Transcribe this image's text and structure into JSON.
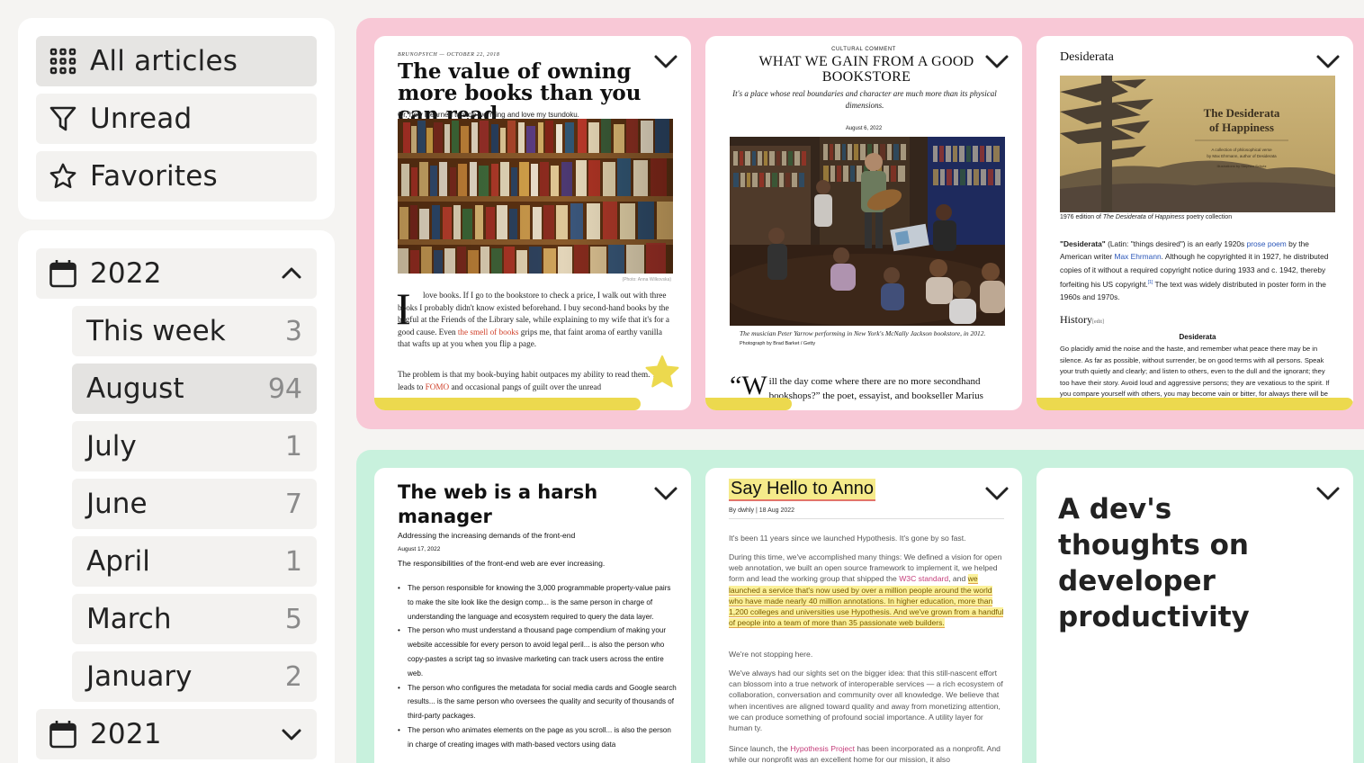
{
  "sidebar": {
    "filters": [
      {
        "label": "All articles",
        "icon": "grid-icon"
      },
      {
        "label": "Unread",
        "icon": "filter-icon"
      },
      {
        "label": "Favorites",
        "icon": "star-icon"
      }
    ],
    "years": [
      {
        "label": "2022",
        "expanded": true
      },
      {
        "label": "2021",
        "expanded": false
      }
    ],
    "months": [
      {
        "label": "This week",
        "count": "3"
      },
      {
        "label": "August",
        "count": "94"
      },
      {
        "label": "July",
        "count": "1"
      },
      {
        "label": "June",
        "count": "7"
      },
      {
        "label": "April",
        "count": "1"
      },
      {
        "label": "March",
        "count": "5"
      },
      {
        "label": "January",
        "count": "2"
      }
    ]
  },
  "cards": {
    "c1": {
      "kicker": "BRUNOPSYCH — OCTOBER 22, 2018",
      "title": "The value of owning more books than you can read",
      "subtitle": "Or, how I learned to stop worrying and love my tsundoku.",
      "caption": "(Photo: Anna Wilkovska)",
      "drop": "I",
      "body_a": "love books. If I go to the bookstore to check a price, I walk out with three books I probably didn't know existed beforehand. I buy second-hand books by the bagful at the Friends of the Library sale, while explaining to my wife that it's for a good cause. Even",
      "body_link": "the smell of books",
      "body_b": "grips me, that faint aroma of earthy vanilla that wafts up at you when you flip a page.",
      "body2_a": "The problem is that my book-buying habit outpaces my ability to read them. This leads to",
      "body2_link": "FOMO",
      "body2_b": "and occasional pangs of guilt over the unread",
      "progress": 0.8
    },
    "c2": {
      "kicker": "CULTURAL COMMENT",
      "title": "WHAT WE GAIN FROM A GOOD BOOKSTORE",
      "subtitle": "It's a place whose real boundaries and character are much more than its physical dimensions.",
      "date": "August 6, 2022",
      "caption_a": "The musician Peter Yarrow performing in New York's McNally Jackson bookstore, in 2012.",
      "caption_b": "Photograph by Brad Barket / Getty",
      "quote_cap": "“W",
      "quote": "ill the day come where there are no more secondhand bookshops?” the poet, essayist, and bookseller Marius",
      "progress": 0.27
    },
    "c3": {
      "title": "Desiderata",
      "img_title": "The Desiderata of Happiness",
      "img_sub": "A collection of philosophical verse by Max Ehrmann, author of Desiderata",
      "img_small": "Illustrations by Stephen Schutz",
      "caption_a": "1976 edition of",
      "caption_b": "The Desiderata of Happiness",
      "caption_c": "poetry collection",
      "body_bold": "\"Desiderata\"",
      "body_a": "(Latin: \"things desired\") is an early 1920s",
      "body_link1": "prose poem",
      "body_b": "by the American writer",
      "body_link2": "Max Ehrmann",
      "body_c": ". Although he copyrighted it in 1927, he distributed copies of it without a required copyright notice during 1933 and c. 1942, thereby forfeiting his US copyright.",
      "body_ref": "[1]",
      "body_d": "The text was widely distributed in poster form in the 1960s and 1970s.",
      "history": "History",
      "history_edit": "[edit]",
      "poem_title": "Desiderata",
      "poem": "Go placidly amid the noise and the haste, and remember what peace there may be in silence. As far as possible, without surrender, be on good terms with all persons. Speak your truth quietly and clearly; and listen to others, even to the dull and the ignorant; they too have their story. Avoid loud and aggressive persons; they are vexatious to the spirit. If you compare yourself with others, you may become vain or bitter, for always there will be",
      "progress": 1.0
    },
    "c4": {
      "title": "The web is a harsh manager",
      "subtitle": "Addressing the increasing demands of the front-end",
      "date": "August 17, 2022",
      "intro": "The responsibilities of the front-end web are ever increasing.",
      "items": [
        "The person responsible for knowing the 3,000 programmable property-value pairs to make the site look like the design comp... is the same person in charge of understanding the language and ecosystem required to query the data layer.",
        "The person who must understand a thousand page compendium of making your website accessible for every person to avoid legal peril... is also the person who copy-pastes a script tag so invasive marketing can track users across the entire web.",
        "The person who configures the metadata for social media cards and Google search results... is the same person who oversees the quality and security of thousands of third-party packages.",
        "The person who animates elements on the page as you scroll... is also the person in charge of creating images with math-based vectors using data"
      ]
    },
    "c5": {
      "title": "Say Hello to Anno",
      "meta": "By dwhly | 18 Aug 2022",
      "p1": "It's been 11 years since we launched Hypothesis. It's gone by so fast.",
      "p2_a": "During this time, we've accomplished many things: We defined a vision for open web annotation, we built an open source framework to implement it, we helped form and lead the working group that shipped the",
      "p2_link": "W3C standard",
      "p2_b": ", and",
      "p2_hl": "we launched a service that's now used by over a million people around the world who have made nearly 40 million annotations. In higher education, more than 1,200 colleges and universities use Hypothesis. And we've grown from a handful of people into a team of more than 35 passionate web builders.",
      "p3": "We're not stopping here.",
      "p4": "We've always had our sights set on the bigger idea: that this still-nascent effort can blossom into a true network of interoperable services — a rich ecosystem of collaboration, conversation and community over all knowledge. We believe that when incentives are aligned toward quality and away from monetizing attention, we can produce something of profound social importance. A utility layer for human ty.",
      "p5_a": "Since launch, the",
      "p5_link": "Hypothesis Project",
      "p5_b": "has been incorporated as a nonprofit. And while our nonprofit was an excellent home for our mission, it also"
    },
    "c6": {
      "title": "A dev's thoughts on developer productivity"
    }
  },
  "colors": {
    "pink_group": "#f8c8d6",
    "mint_group": "#c8f1dd",
    "progress": "#ecd94e",
    "favorite_star": "#ecd94e"
  }
}
